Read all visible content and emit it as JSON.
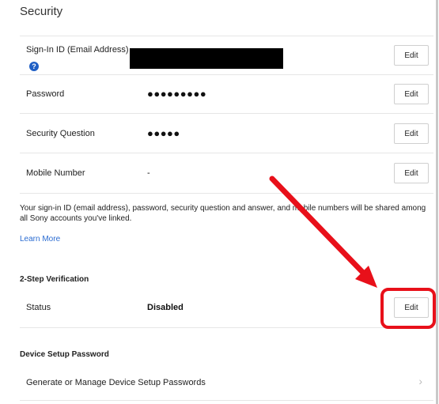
{
  "page": {
    "title": "Security"
  },
  "rows": [
    {
      "label": "Sign-In ID (Email Address)",
      "value": "",
      "edit": "Edit"
    },
    {
      "label": "Password",
      "value": "●●●●●●●●●",
      "edit": "Edit"
    },
    {
      "label": "Security Question",
      "value": "●●●●●",
      "edit": "Edit"
    },
    {
      "label": "Mobile Number",
      "value": "-",
      "edit": "Edit"
    }
  ],
  "help_icon": "?",
  "description": "Your sign-in ID (email address), password, security question and answer, and mobile numbers will be shared among all Sony accounts you've linked.",
  "learn_more": "Learn More",
  "two_step": {
    "heading": "2-Step Verification",
    "status_label": "Status",
    "status_value": "Disabled",
    "edit": "Edit"
  },
  "device_setup": {
    "heading": "Device Setup Password",
    "link_label": "Generate or Manage Device Setup Passwords",
    "chevron": "›"
  },
  "annotation": {
    "color": "#e8101a"
  }
}
